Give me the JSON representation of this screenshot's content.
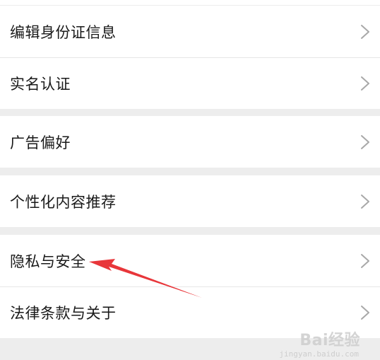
{
  "settings_list": {
    "sections": [
      {
        "items": [
          {
            "label": "编辑身份证信息",
            "icon": "chevron-right-icon"
          },
          {
            "label": "实名认证",
            "icon": "chevron-right-icon"
          }
        ]
      },
      {
        "items": [
          {
            "label": "广告偏好",
            "icon": "chevron-right-icon"
          }
        ]
      },
      {
        "items": [
          {
            "label": "个性化内容推荐",
            "icon": "chevron-right-icon"
          }
        ]
      },
      {
        "items": [
          {
            "label": "隐私与安全",
            "icon": "chevron-right-icon"
          },
          {
            "label": "法律条款与关于",
            "icon": "chevron-right-icon"
          }
        ]
      }
    ]
  },
  "annotation": {
    "arrow_color": "#e8363a",
    "points_to": "隐私与安全"
  },
  "watermark": {
    "text": "Bai经验",
    "subtext": "jingyan.baidu.com"
  },
  "colors": {
    "page_background": "#ededed",
    "row_background": "#ffffff",
    "text": "#1a1a1a",
    "chevron": "#a8a8a8",
    "divider": "#e6e6e6"
  }
}
